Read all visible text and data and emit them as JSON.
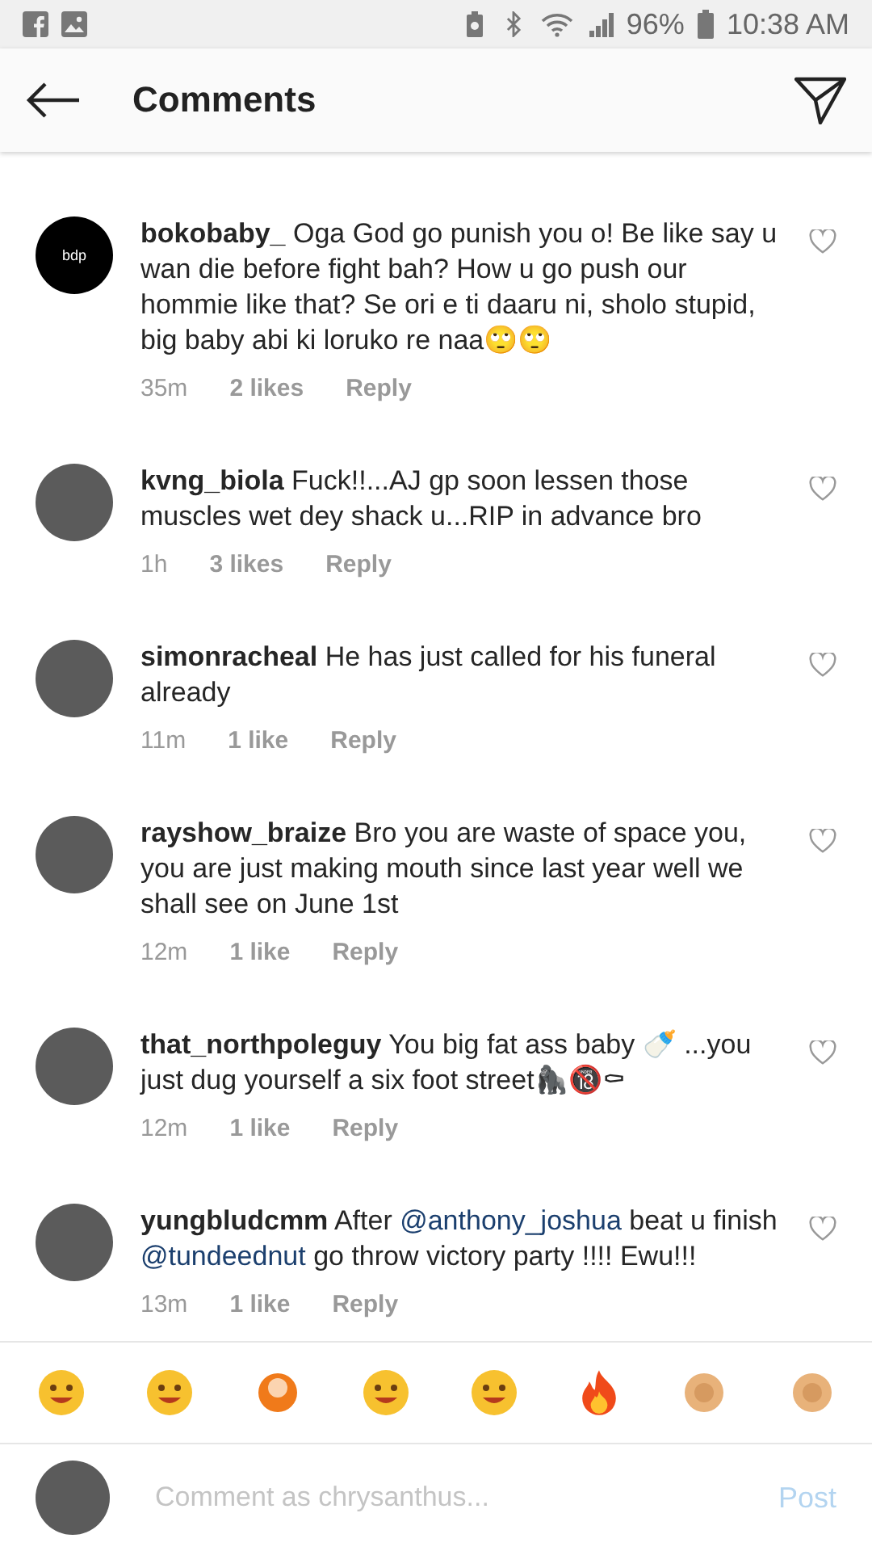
{
  "status_bar": {
    "battery": "96%",
    "time": "10:38 AM"
  },
  "header": {
    "title": "Comments"
  },
  "comments": [
    {
      "username": "bokobaby_",
      "kind": "logo",
      "avatar_text": "bdp",
      "parts": [
        {
          "kind": "text",
          "text": "Oga God go punish you o! Be like say u wan die before fight bah? How u go push our hommie like that? Se ori e ti daaru ni, sholo stupid, big baby abi ki loruko re naa🙄🙄"
        }
      ],
      "time": "35m",
      "likes": "2 likes",
      "reply": "Reply"
    },
    {
      "username": "kvng_biola",
      "kind": "photo",
      "parts": [
        {
          "kind": "text",
          "text": "Fuck!!...AJ gp soon lessen those muscles wet dey shack u...RIP in advance bro"
        }
      ],
      "time": "1h",
      "likes": "3 likes",
      "reply": "Reply"
    },
    {
      "username": "simonracheal",
      "kind": "photo",
      "parts": [
        {
          "kind": "text",
          "text": "He has just called for his funeral already"
        }
      ],
      "time": "11m",
      "likes": "1 like",
      "reply": "Reply"
    },
    {
      "username": "rayshow_braize",
      "kind": "photo",
      "parts": [
        {
          "kind": "text",
          "text": "Bro you are waste of space you, you are just making mouth since last year well we shall see on June 1st"
        }
      ],
      "time": "12m",
      "likes": "1 like",
      "reply": "Reply"
    },
    {
      "username": "that_northpoleguy",
      "kind": "photo",
      "parts": [
        {
          "kind": "text",
          "text": "You big fat ass baby 🍼 ...you just dug yourself a six foot street🦍🔞⚰"
        }
      ],
      "time": "12m",
      "likes": "1 like",
      "reply": "Reply"
    },
    {
      "username": "yungbludcmm",
      "kind": "photo",
      "parts": [
        {
          "kind": "text",
          "text": "After "
        },
        {
          "kind": "mention",
          "text": "@anthony_joshua"
        },
        {
          "kind": "text",
          "text": " beat u finish "
        },
        {
          "kind": "mention",
          "text": "@tundeednut"
        },
        {
          "kind": "text",
          "text": " go throw victory party !!!! Ewu!!!"
        }
      ],
      "time": "13m",
      "likes": "1 like",
      "reply": "Reply"
    }
  ],
  "composer": {
    "placeholder": "Comment as chrysanthus...",
    "post": "Post"
  }
}
